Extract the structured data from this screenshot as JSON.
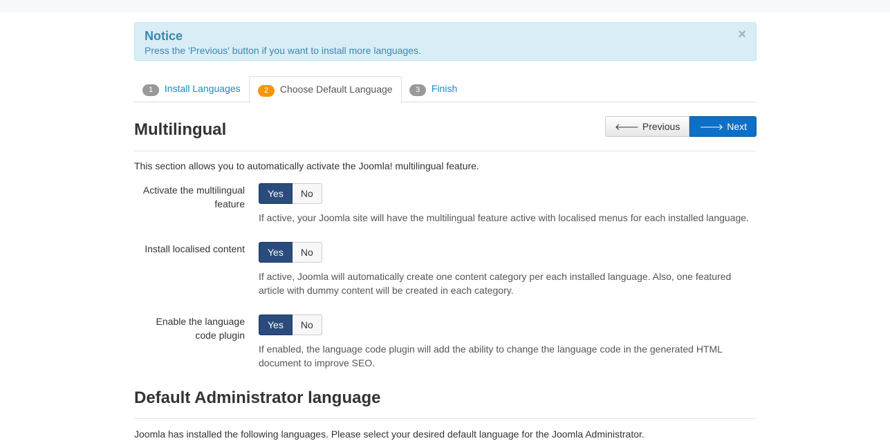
{
  "notice": {
    "title": "Notice",
    "message": "Press the 'Previous' button if you want to install more languages.",
    "close_glyph": "×"
  },
  "tabs": [
    {
      "number": "1",
      "label": "Install Languages"
    },
    {
      "number": "2",
      "label": "Choose Default Language"
    },
    {
      "number": "3",
      "label": "Finish"
    }
  ],
  "section1": {
    "title": "Multilingual",
    "intro": "This section allows you to automatically activate the Joomla! multilingual feature."
  },
  "buttons": {
    "previous": "Previous",
    "next": "Next"
  },
  "fields": [
    {
      "label": "Activate the multilingual feature",
      "yes": "Yes",
      "no": "No",
      "selected": "Yes",
      "help": "If active, your Joomla site will have the multilingual feature active with localised menus for each installed language."
    },
    {
      "label": "Install localised content",
      "yes": "Yes",
      "no": "No",
      "selected": "Yes",
      "help": "If active, Joomla will automatically create one content category per each installed language. Also, one featured article with dummy content will be created in each category."
    },
    {
      "label": "Enable the language code plugin",
      "yes": "Yes",
      "no": "No",
      "selected": "Yes",
      "help": "If enabled, the language code plugin will add the ability to change the language code in the generated HTML document to improve SEO."
    }
  ],
  "section2": {
    "title": "Default Administrator language",
    "intro": "Joomla has installed the following languages. Please select your desired default language for the Joomla Administrator."
  },
  "colors": {
    "accent": "#1a8ac6",
    "next_button": "#0e6fc6",
    "toggle_selected": "#2a4b7c",
    "active_badge": "#f89406",
    "notice_bg": "#d9edf7"
  }
}
